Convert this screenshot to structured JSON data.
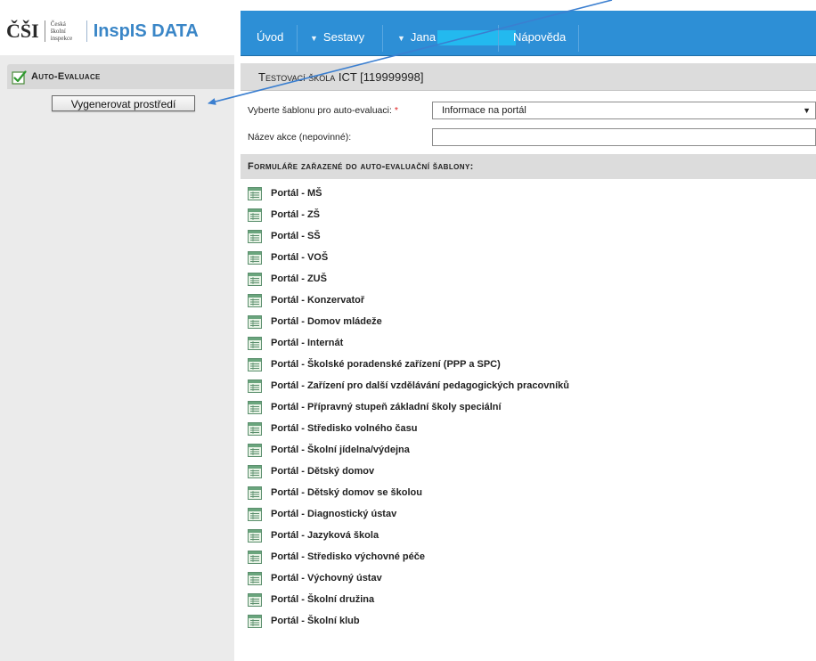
{
  "header": {
    "logo_mark": "ČŠI",
    "logo_subtitle": "Česká školní inspekce",
    "app_name": "InspIS DATA",
    "nav": {
      "uvod": "Úvod",
      "sestavy": "Sestavy",
      "user": "Jana",
      "napoveda": "Nápověda"
    }
  },
  "sidebar": {
    "section_title": "Auto-Evaluace",
    "generate_button": "Vygenerovat prostředí"
  },
  "main": {
    "school_title": "Testovací škola ICT [119999998]",
    "template_label": "Vyberte šablonu pro auto-evaluaci:",
    "template_required_mark": "*",
    "template_value": "Informace na portál",
    "action_label": "Název akce (nepovinné):",
    "action_value": "",
    "forms_heading": "Formuláře zařazené do auto-evaluační šablony:",
    "forms": [
      "Portál - MŠ",
      "Portál - ZŠ",
      "Portál - SŠ",
      "Portál - VOŠ",
      "Portál - ZUŠ",
      "Portál - Konzervatoř",
      "Portál - Domov mládeže",
      "Portál - Internát",
      "Portál - Školské poradenské zařízení (PPP a SPC)",
      "Portál - Zařízení pro další vzdělávání pedagogických pracovníků",
      "Portál - Přípravný stupeň základní školy speciální",
      "Portál - Středisko volného času",
      "Portál - Školní jídelna/výdejna",
      "Portál - Dětský domov",
      "Portál - Dětský domov se školou",
      "Portál - Diagnostický ústav",
      "Portál - Jazyková škola",
      "Portál - Středisko výchovné péče",
      "Portál - Výchovný ústav",
      "Portál - Školní družina",
      "Portál - Školní klub"
    ]
  },
  "colors": {
    "nav_bar": "#2d8fd6",
    "logo_blue": "#3a86c7",
    "annotation_arrow": "#3b7fd0",
    "redaction": "#23b9ef"
  },
  "icons": {
    "sidebar_check": "checkbox-checked-icon",
    "form_item": "form-document-icon",
    "nav_dropdown": "triangle-down-icon",
    "select_caret": "caret-down-icon"
  }
}
